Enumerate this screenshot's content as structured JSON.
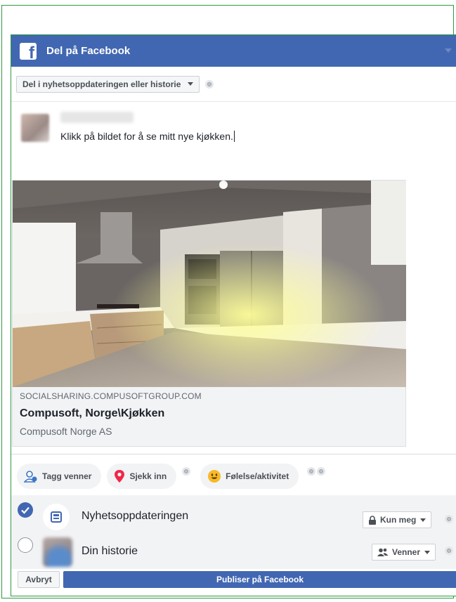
{
  "dialog": {
    "title": "Del på Facebook",
    "header_icon": "facebook-logo-icon"
  },
  "share": {
    "selected": "Del i nyhetsoppdateringen eller historie"
  },
  "composer": {
    "status_text": "Klikk på bildet for å se mitt nye kjøkken."
  },
  "link_preview": {
    "domain": "SOCIALSHARING.COMPUSOFTGROUP.COM",
    "title": "Compusoft, Norge\\Kjøkken",
    "description": "Compusoft Norge AS",
    "image_icon": "kitchen-photo"
  },
  "actions": {
    "tag_friends": "Tagg venner",
    "check_in": "Sjekk inn",
    "feeling_activity": "Følelse/aktivitet"
  },
  "audience": {
    "news_feed": {
      "label": "Nyhetsoppdateringen",
      "checked": true,
      "privacy": "Kun meg"
    },
    "story": {
      "label": "Din historie",
      "checked": false,
      "privacy": "Venner"
    }
  },
  "footer": {
    "cancel": "Avbryt",
    "publish": "Publiser på Facebook"
  },
  "colors": {
    "brand": "#4267b2",
    "frame": "#2e9a43"
  }
}
